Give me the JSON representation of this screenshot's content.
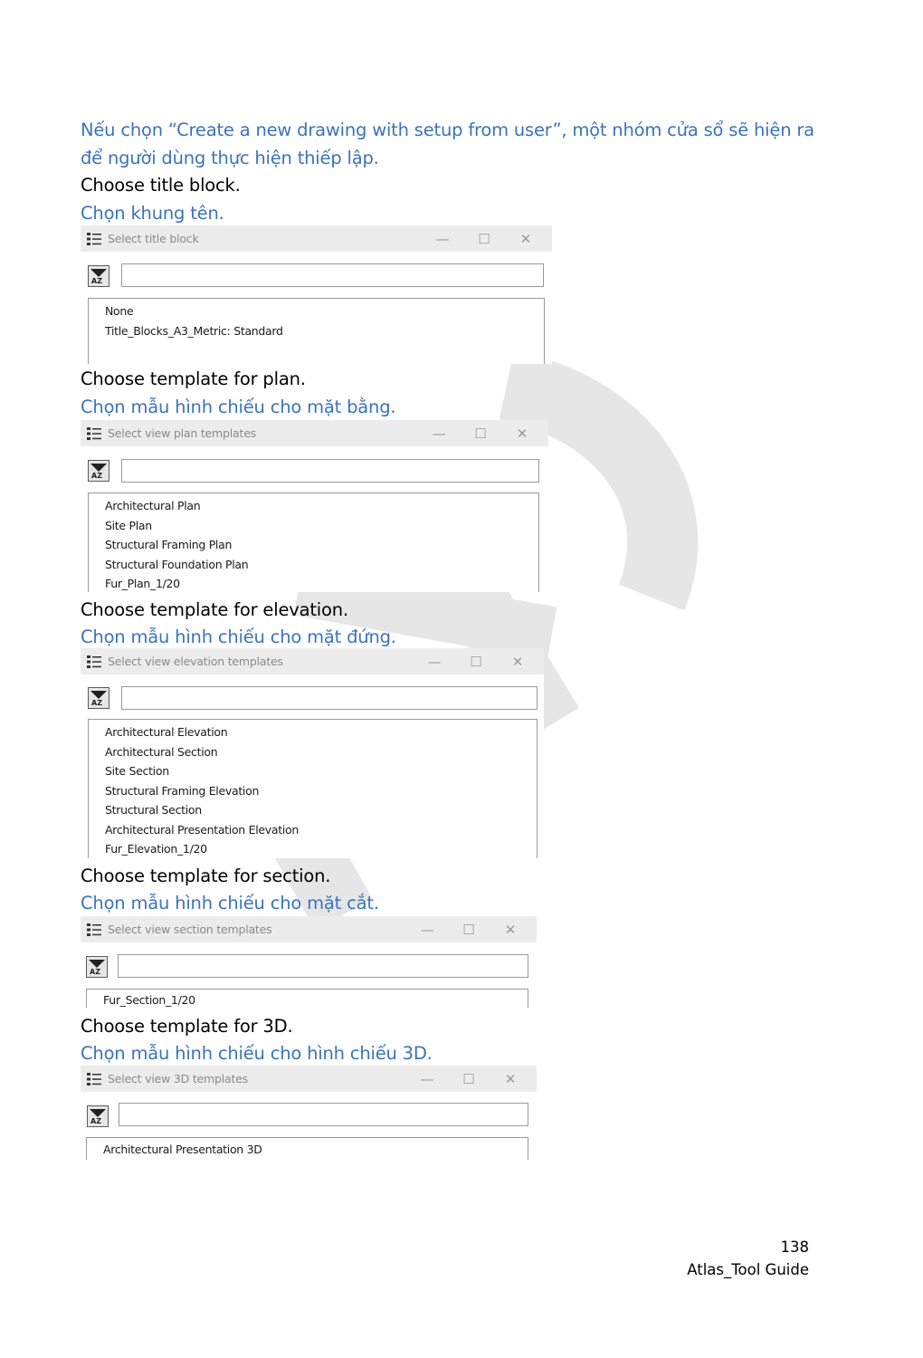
{
  "intro": {
    "text": "Nếu chọn “Create a new drawing with setup from user”, một nhóm cửa sổ sẽ hiện ra để người dùng thực hiện thiếp lập."
  },
  "sections": [
    {
      "en": "Choose title block.",
      "vi": "Chọn khung tên.",
      "dialog": {
        "title": "Select title block",
        "search_value": "",
        "items": [
          "None",
          "Title_Blocks_A3_Metric: Standard"
        ]
      }
    },
    {
      "en": "Choose template for plan.",
      "vi": "Chọn mẫu hình chiếu cho mặt bằng.",
      "dialog": {
        "title": "Select view plan templates",
        "search_value": "",
        "items": [
          "Architectural Plan",
          "Site Plan",
          "Structural Framing Plan",
          "Structural Foundation Plan",
          "Fur_Plan_1/20"
        ]
      }
    },
    {
      "en": "Choose template for elevation.",
      "vi": "Chọn mẫu hình chiếu cho mặt đứng.",
      "dialog": {
        "title": "Select view elevation templates",
        "search_value": "",
        "items": [
          "Architectural Elevation",
          "Architectural Section",
          "Site Section",
          "Structural Framing Elevation",
          "Structural Section",
          "Architectural Presentation Elevation",
          "Fur_Elevation_1/20"
        ]
      }
    },
    {
      "en": "Choose template for section.",
      "vi": "Chọn mẫu hình chiếu cho mặt cắt.",
      "dialog": {
        "title": "Select view section templates",
        "search_value": "",
        "items": [
          "Fur_Section_1/20"
        ]
      }
    },
    {
      "en": "Choose template for 3D.",
      "vi": "Chọn mẫu hình chiếu cho hình chiếu 3D.",
      "dialog": {
        "title": "Select view 3D templates",
        "search_value": "",
        "items": [
          "Architectural Presentation 3D"
        ]
      }
    }
  ],
  "window_controls": {
    "minimize": "—",
    "maximize": "☐",
    "close": "✕"
  },
  "sort_icon_label": "AZ",
  "footer": {
    "page_number": "138",
    "doc_title": "Atlas_Tool Guide"
  },
  "colors": {
    "vietnamese_text": "#3b73b9",
    "titlebar": "#ececec",
    "watermark": "#e6e6e6"
  }
}
